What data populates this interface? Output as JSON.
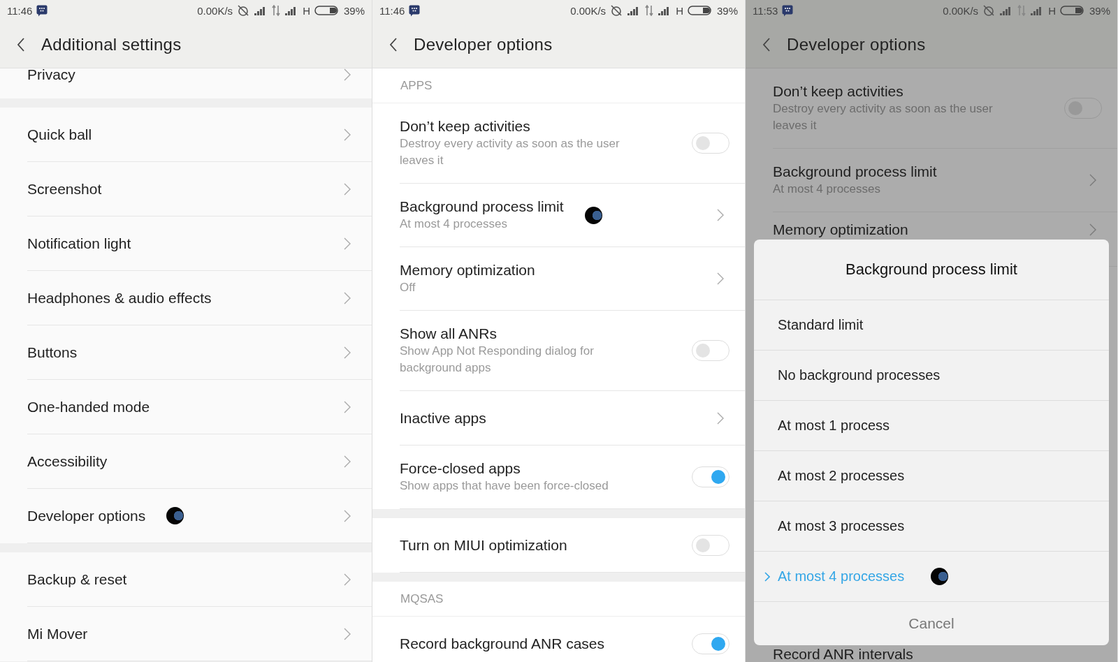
{
  "screens": [
    {
      "status_bar": {
        "time": "11:46",
        "speed": "0.00K/s",
        "network": "H",
        "battery": "39%"
      },
      "title": "Additional settings",
      "dimmed": false,
      "items": [
        {
          "kind": "partial",
          "title": "Privacy"
        },
        {
          "kind": "gap"
        },
        {
          "kind": "nav",
          "title": "Quick ball"
        },
        {
          "kind": "nav",
          "title": "Screenshot"
        },
        {
          "kind": "nav",
          "title": "Notification light"
        },
        {
          "kind": "nav",
          "title": "Headphones & audio effects"
        },
        {
          "kind": "nav",
          "title": "Buttons"
        },
        {
          "kind": "nav",
          "title": "One-handed mode"
        },
        {
          "kind": "nav",
          "title": "Accessibility"
        },
        {
          "kind": "nav",
          "title": "Developer options",
          "touch": true
        },
        {
          "kind": "gap"
        },
        {
          "kind": "nav",
          "title": "Backup & reset"
        },
        {
          "kind": "nav",
          "title": "Mi Mover"
        },
        {
          "kind": "gap"
        }
      ]
    },
    {
      "status_bar": {
        "time": "11:46",
        "speed": "0.00K/s",
        "network": "H",
        "battery": "39%"
      },
      "title": "Developer options",
      "dimmed": false,
      "items": [
        {
          "kind": "section",
          "title": "APPS"
        },
        {
          "kind": "toggle",
          "title": "Don’t keep activities",
          "subtitle": "Destroy every activity as soon as the user leaves it",
          "on": false
        },
        {
          "kind": "nav",
          "title": "Background process limit",
          "subtitle": "At most 4 processes",
          "touch": true
        },
        {
          "kind": "nav",
          "title": "Memory optimization",
          "subtitle": "Off"
        },
        {
          "kind": "toggle",
          "title": "Show all ANRs",
          "subtitle": "Show App Not Responding dialog for background apps",
          "on": false
        },
        {
          "kind": "nav",
          "title": "Inactive apps"
        },
        {
          "kind": "toggle",
          "title": "Force-closed apps",
          "subtitle": "Show apps that have been force-closed",
          "on": true
        },
        {
          "kind": "gap"
        },
        {
          "kind": "toggle",
          "title": "Turn on MIUI optimization",
          "on": false
        },
        {
          "kind": "gap"
        },
        {
          "kind": "section",
          "title": "MQSAS"
        },
        {
          "kind": "toggle",
          "title": "Record background ANR cases",
          "on": true
        }
      ]
    },
    {
      "status_bar": {
        "time": "11:53",
        "speed": "0.00K/s",
        "network": "H",
        "battery": "39%"
      },
      "title": "Developer options",
      "dimmed": true,
      "items": [
        {
          "kind": "toggle",
          "title": "Don’t keep activities",
          "subtitle": "Destroy every activity as soon as the user leaves it",
          "on": false
        },
        {
          "kind": "nav",
          "title": "Background process limit",
          "subtitle": "At most 4 processes"
        },
        {
          "kind": "nav",
          "title": "Memory optimization"
        },
        {
          "kind": "bottom",
          "title": "Record ANR intervals"
        }
      ],
      "dialog": {
        "title": "Background process limit",
        "options": [
          {
            "label": "Standard limit",
            "selected": false
          },
          {
            "label": "No background processes",
            "selected": false
          },
          {
            "label": "At most 1 process",
            "selected": false
          },
          {
            "label": "At most 2 processes",
            "selected": false
          },
          {
            "label": "At most 3 processes",
            "selected": false
          },
          {
            "label": "At most 4 processes",
            "selected": true,
            "touch": true
          }
        ],
        "cancel": "Cancel"
      }
    }
  ]
}
